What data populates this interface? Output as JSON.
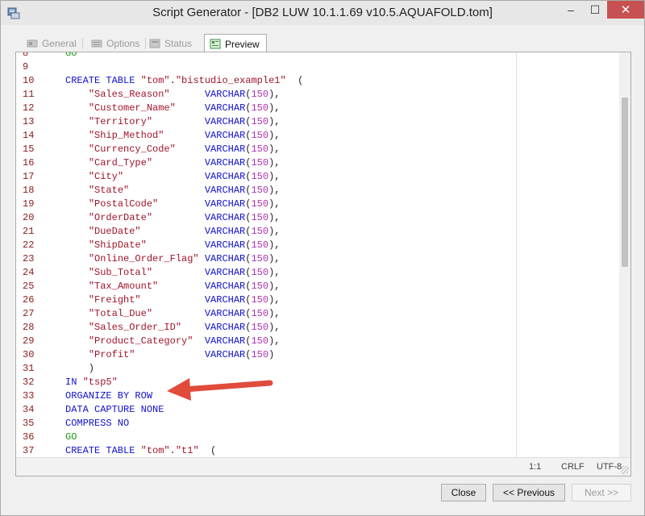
{
  "window": {
    "title": "Script Generator - [DB2 LUW 10.1.1.69 v10.5.AQUAFOLD.tom]",
    "controls": {
      "minimize": "–",
      "maximize": "☐",
      "close": "✕"
    }
  },
  "tabs": [
    {
      "label": "General",
      "icon": "wizard-icon",
      "active": false
    },
    {
      "label": "Options",
      "icon": "options-icon",
      "active": false
    },
    {
      "label": "Status",
      "icon": "status-icon",
      "active": false
    },
    {
      "label": "Preview",
      "icon": "preview-icon",
      "active": true
    }
  ],
  "editor": {
    "first_line_number": 8,
    "lines": [
      [
        [
          "go",
          "GO"
        ]
      ],
      [],
      [
        [
          "kw",
          "CREATE TABLE "
        ],
        [
          "str",
          "\"tom\""
        ],
        [
          "pun",
          "."
        ],
        [
          "str",
          "\"bistudio_example1\""
        ],
        [
          "pun",
          "  ("
        ]
      ],
      [
        [
          "pun",
          "    "
        ],
        [
          "str",
          "\"Sales_Reason\""
        ],
        [
          "pun",
          "      "
        ],
        [
          "type",
          "VARCHAR"
        ],
        [
          "pun",
          "("
        ],
        [
          "num",
          "150"
        ],
        [
          "pun",
          "),"
        ]
      ],
      [
        [
          "pun",
          "    "
        ],
        [
          "str",
          "\"Customer_Name\""
        ],
        [
          "pun",
          "     "
        ],
        [
          "type",
          "VARCHAR"
        ],
        [
          "pun",
          "("
        ],
        [
          "num",
          "150"
        ],
        [
          "pun",
          "),"
        ]
      ],
      [
        [
          "pun",
          "    "
        ],
        [
          "str",
          "\"Territory\""
        ],
        [
          "pun",
          "         "
        ],
        [
          "type",
          "VARCHAR"
        ],
        [
          "pun",
          "("
        ],
        [
          "num",
          "150"
        ],
        [
          "pun",
          "),"
        ]
      ],
      [
        [
          "pun",
          "    "
        ],
        [
          "str",
          "\"Ship_Method\""
        ],
        [
          "pun",
          "       "
        ],
        [
          "type",
          "VARCHAR"
        ],
        [
          "pun",
          "("
        ],
        [
          "num",
          "150"
        ],
        [
          "pun",
          "),"
        ]
      ],
      [
        [
          "pun",
          "    "
        ],
        [
          "str",
          "\"Currency_Code\""
        ],
        [
          "pun",
          "     "
        ],
        [
          "type",
          "VARCHAR"
        ],
        [
          "pun",
          "("
        ],
        [
          "num",
          "150"
        ],
        [
          "pun",
          "),"
        ]
      ],
      [
        [
          "pun",
          "    "
        ],
        [
          "str",
          "\"Card_Type\""
        ],
        [
          "pun",
          "         "
        ],
        [
          "type",
          "VARCHAR"
        ],
        [
          "pun",
          "("
        ],
        [
          "num",
          "150"
        ],
        [
          "pun",
          "),"
        ]
      ],
      [
        [
          "pun",
          "    "
        ],
        [
          "str",
          "\"City\""
        ],
        [
          "pun",
          "              "
        ],
        [
          "type",
          "VARCHAR"
        ],
        [
          "pun",
          "("
        ],
        [
          "num",
          "150"
        ],
        [
          "pun",
          "),"
        ]
      ],
      [
        [
          "pun",
          "    "
        ],
        [
          "str",
          "\"State\""
        ],
        [
          "pun",
          "             "
        ],
        [
          "type",
          "VARCHAR"
        ],
        [
          "pun",
          "("
        ],
        [
          "num",
          "150"
        ],
        [
          "pun",
          "),"
        ]
      ],
      [
        [
          "pun",
          "    "
        ],
        [
          "str",
          "\"PostalCode\""
        ],
        [
          "pun",
          "        "
        ],
        [
          "type",
          "VARCHAR"
        ],
        [
          "pun",
          "("
        ],
        [
          "num",
          "150"
        ],
        [
          "pun",
          "),"
        ]
      ],
      [
        [
          "pun",
          "    "
        ],
        [
          "str",
          "\"OrderDate\""
        ],
        [
          "pun",
          "         "
        ],
        [
          "type",
          "VARCHAR"
        ],
        [
          "pun",
          "("
        ],
        [
          "num",
          "150"
        ],
        [
          "pun",
          "),"
        ]
      ],
      [
        [
          "pun",
          "    "
        ],
        [
          "str",
          "\"DueDate\""
        ],
        [
          "pun",
          "           "
        ],
        [
          "type",
          "VARCHAR"
        ],
        [
          "pun",
          "("
        ],
        [
          "num",
          "150"
        ],
        [
          "pun",
          "),"
        ]
      ],
      [
        [
          "pun",
          "    "
        ],
        [
          "str",
          "\"ShipDate\""
        ],
        [
          "pun",
          "          "
        ],
        [
          "type",
          "VARCHAR"
        ],
        [
          "pun",
          "("
        ],
        [
          "num",
          "150"
        ],
        [
          "pun",
          "),"
        ]
      ],
      [
        [
          "pun",
          "    "
        ],
        [
          "str",
          "\"Online_Order_Flag\""
        ],
        [
          "pun",
          " "
        ],
        [
          "type",
          "VARCHAR"
        ],
        [
          "pun",
          "("
        ],
        [
          "num",
          "150"
        ],
        [
          "pun",
          "),"
        ]
      ],
      [
        [
          "pun",
          "    "
        ],
        [
          "str",
          "\"Sub_Total\""
        ],
        [
          "pun",
          "         "
        ],
        [
          "type",
          "VARCHAR"
        ],
        [
          "pun",
          "("
        ],
        [
          "num",
          "150"
        ],
        [
          "pun",
          "),"
        ]
      ],
      [
        [
          "pun",
          "    "
        ],
        [
          "str",
          "\"Tax_Amount\""
        ],
        [
          "pun",
          "        "
        ],
        [
          "type",
          "VARCHAR"
        ],
        [
          "pun",
          "("
        ],
        [
          "num",
          "150"
        ],
        [
          "pun",
          "),"
        ]
      ],
      [
        [
          "pun",
          "    "
        ],
        [
          "str",
          "\"Freight\""
        ],
        [
          "pun",
          "           "
        ],
        [
          "type",
          "VARCHAR"
        ],
        [
          "pun",
          "("
        ],
        [
          "num",
          "150"
        ],
        [
          "pun",
          "),"
        ]
      ],
      [
        [
          "pun",
          "    "
        ],
        [
          "str",
          "\"Total_Due\""
        ],
        [
          "pun",
          "         "
        ],
        [
          "type",
          "VARCHAR"
        ],
        [
          "pun",
          "("
        ],
        [
          "num",
          "150"
        ],
        [
          "pun",
          "),"
        ]
      ],
      [
        [
          "pun",
          "    "
        ],
        [
          "str",
          "\"Sales_Order_ID\""
        ],
        [
          "pun",
          "    "
        ],
        [
          "type",
          "VARCHAR"
        ],
        [
          "pun",
          "("
        ],
        [
          "num",
          "150"
        ],
        [
          "pun",
          "),"
        ]
      ],
      [
        [
          "pun",
          "    "
        ],
        [
          "str",
          "\"Product_Category\""
        ],
        [
          "pun",
          "  "
        ],
        [
          "type",
          "VARCHAR"
        ],
        [
          "pun",
          "("
        ],
        [
          "num",
          "150"
        ],
        [
          "pun",
          "),"
        ]
      ],
      [
        [
          "pun",
          "    "
        ],
        [
          "str",
          "\"Profit\""
        ],
        [
          "pun",
          "            "
        ],
        [
          "type",
          "VARCHAR"
        ],
        [
          "pun",
          "("
        ],
        [
          "num",
          "150"
        ],
        [
          "pun",
          ")"
        ]
      ],
      [
        [
          "pun",
          "    )"
        ]
      ],
      [
        [
          "kw",
          "IN "
        ],
        [
          "str",
          "\"tsp5\""
        ]
      ],
      [
        [
          "kw",
          "ORGANIZE BY ROW"
        ]
      ],
      [
        [
          "kw",
          "DATA CAPTURE NONE"
        ]
      ],
      [
        [
          "kw",
          "COMPRESS NO"
        ]
      ],
      [
        [
          "go",
          "GO"
        ]
      ],
      [
        [
          "kw",
          "CREATE TABLE "
        ],
        [
          "str",
          "\"tom\""
        ],
        [
          "pun",
          "."
        ],
        [
          "str",
          "\"t1\""
        ],
        [
          "pun",
          "  ("
        ]
      ]
    ]
  },
  "status": {
    "position": "1:1",
    "line_ending": "CRLF",
    "encoding": "UTF-8"
  },
  "buttons": {
    "close": "Close",
    "previous": "<< Previous",
    "next": "Next >>"
  },
  "colors": {
    "arrow": "#e04b3c",
    "keyword": "#1010d0",
    "string": "#a0142a",
    "number": "#b030b0",
    "go": "#1a9a1a",
    "line_number": "#8b1a1a"
  }
}
